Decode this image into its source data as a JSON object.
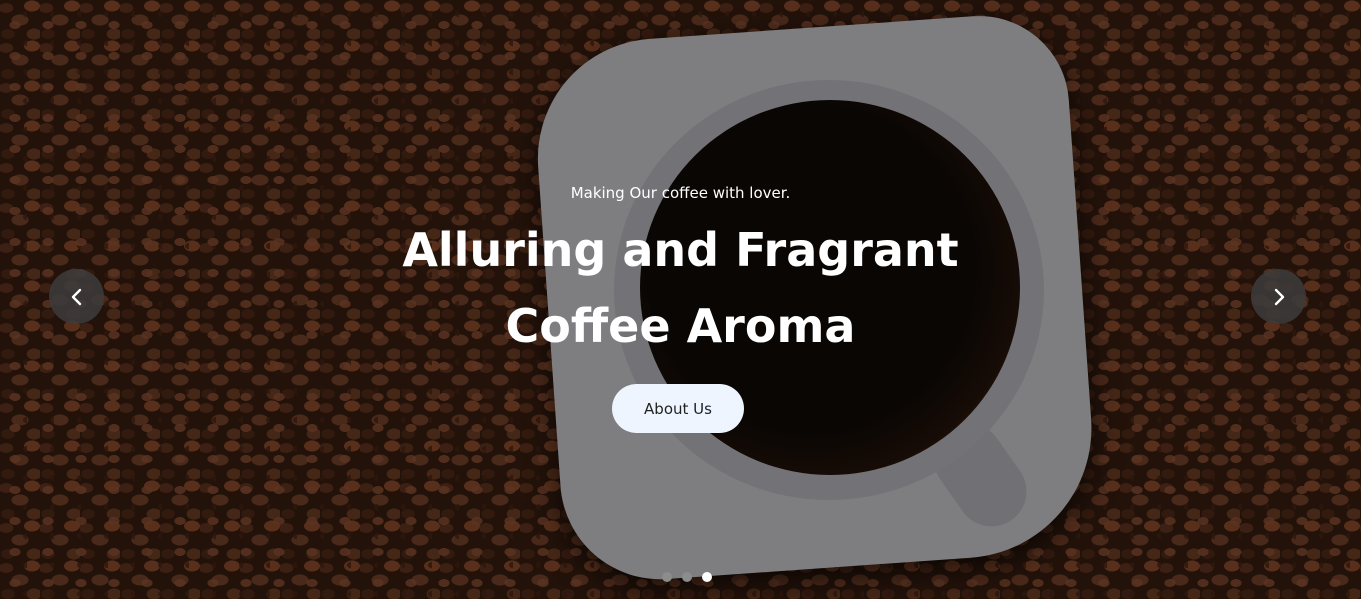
{
  "hero": {
    "tagline": "Making Our coffee with lover.",
    "headline_line1": "Alluring and Fragrant",
    "headline_line2": "Coffee Aroma",
    "cta_label": "About Us"
  },
  "carousel": {
    "prev_icon": "chevron-left-icon",
    "next_icon": "chevron-right-icon",
    "slide_count": 3,
    "active_slide": 3
  },
  "colors": {
    "button_bg": "#eef5ff",
    "nav_bg": "#3c3c3c",
    "dot_active": "#ffffff",
    "dot_inactive": "#8c8c8c"
  }
}
